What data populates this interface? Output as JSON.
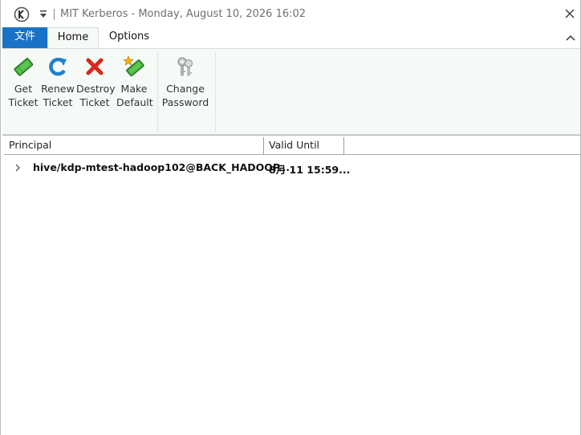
{
  "window": {
    "title": "MIT Kerberos - Monday, August 10, 2026  16:02",
    "close_symbol": "✕"
  },
  "tabs": [
    {
      "label": "文件"
    },
    {
      "label": "Home"
    },
    {
      "label": "Options"
    }
  ],
  "ribbon": {
    "buttons": [
      {
        "label": "Get\nTicket",
        "icon": "get-ticket-icon"
      },
      {
        "label": "Renew\nTicket",
        "icon": "renew-ticket-icon"
      },
      {
        "label": "Destroy\nTicket",
        "icon": "destroy-ticket-icon"
      },
      {
        "label": "Make\nDefault",
        "icon": "make-default-icon"
      },
      {
        "label": "Change\nPassword",
        "icon": "keys-icon"
      }
    ]
  },
  "list": {
    "columns": [
      "Principal",
      "Valid Until"
    ],
    "rows": [
      {
        "principal": "hive/kdp-mtest-hadoop102@BACK_HADOOP...",
        "valid_until": "8月 11  15:59..."
      }
    ]
  },
  "colors": {
    "file_tab": "#1a72c6",
    "ribbon_bg": "#f6faf7",
    "ticket_green": "#3fa637",
    "renew_blue": "#1f82c9",
    "destroy_red": "#d9271e"
  }
}
